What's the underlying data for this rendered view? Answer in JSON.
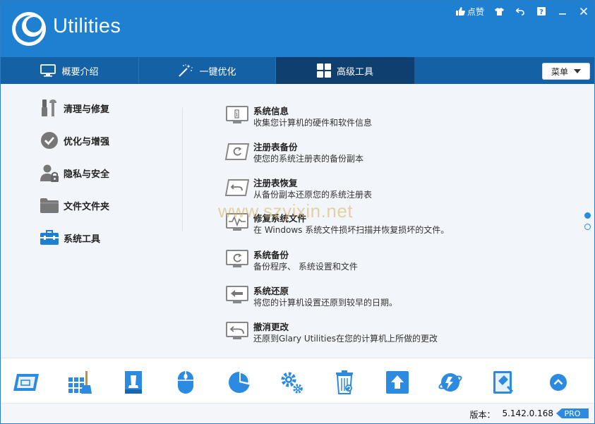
{
  "app": {
    "title": "Utilities"
  },
  "title_controls": {
    "like_label": "点赞"
  },
  "nav": {
    "tabs": [
      {
        "label": "概要介绍",
        "icon": "monitor-icon"
      },
      {
        "label": "一键优化",
        "icon": "magic-wand-icon"
      },
      {
        "label": "高级工具",
        "icon": "grid-icon",
        "active": true
      }
    ],
    "menu_label": "菜单"
  },
  "categories": [
    {
      "label": "清理与修复",
      "icon": "brush-wrench-icon"
    },
    {
      "label": "优化与增强",
      "icon": "checkmark-circle-icon"
    },
    {
      "label": "隐私与安全",
      "icon": "user-lock-icon"
    },
    {
      "label": "文件文件夹",
      "icon": "folder-icon"
    },
    {
      "label": "系统工具",
      "icon": "toolbox-icon",
      "active": true
    }
  ],
  "tools": [
    {
      "name": "系统信息",
      "desc": "收集您计算机的硬件和软件信息",
      "icon": "system-info-icon"
    },
    {
      "name": "注册表备份",
      "desc": "使您的系统注册表的备份副本",
      "icon": "registry-backup-icon"
    },
    {
      "name": "注册表恢复",
      "desc": "从备份副本还原您的系统注册表",
      "icon": "registry-restore-icon"
    },
    {
      "name": "修复系统文件",
      "desc": "在 Windows 系统文件损坏扫描并恢复损坏的文件。",
      "icon": "repair-system-files-icon"
    },
    {
      "name": "系统备份",
      "desc": "备份程序、 系统设置和文件",
      "icon": "system-backup-icon"
    },
    {
      "name": "系统还原",
      "desc": "将您的计算机设置还原到较早的日期。",
      "icon": "system-restore-icon"
    },
    {
      "name": "撤消更改",
      "desc": "还原到Glary Utilities在您的计算机上所做的更改",
      "icon": "undo-changes-icon"
    }
  ],
  "watermark": "www.szyixin.net",
  "bottom_toolbar": [
    "disk-cleaner-icon",
    "registry-cleaner-icon",
    "disk-repair-icon",
    "mouse-icon",
    "pie-chart-icon",
    "gears-icon",
    "recycle-bin-icon",
    "upload-icon",
    "planet-icon",
    "tools-card-icon",
    "scroll-up-icon"
  ],
  "status": {
    "version_label": "版本：",
    "version_value": "5.142.0.168",
    "badge": "PRO"
  },
  "colors": {
    "header": "#1f7fd0",
    "navbar": "#1561a5",
    "nav_active": "#0f3f6e",
    "accent": "#2c8be0"
  }
}
